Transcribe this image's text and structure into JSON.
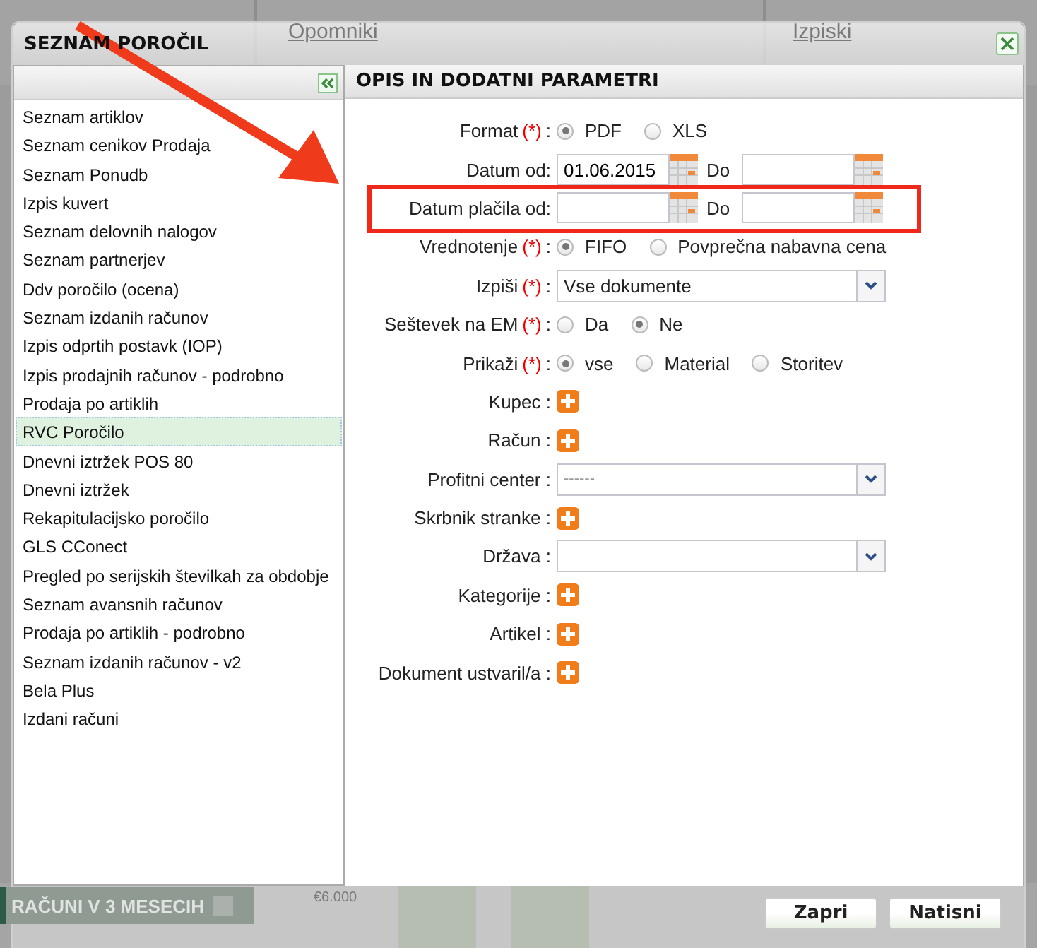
{
  "background": {
    "links": [
      "Opomniki",
      "Izpiski"
    ],
    "panel_title": "RAČUNI V 3 MESECIH",
    "axis_label": "€6.000"
  },
  "dialog": {
    "title": "SEZNAM POROČIL",
    "reports": [
      {
        "label": "Seznam artiklov",
        "selected": false
      },
      {
        "label": "Seznam cenikov Prodaja",
        "selected": false
      },
      {
        "label": "Seznam Ponudb",
        "selected": false
      },
      {
        "label": "Izpis kuvert",
        "selected": false
      },
      {
        "label": "Seznam delovnih nalogov",
        "selected": false
      },
      {
        "label": "Seznam partnerjev",
        "selected": false
      },
      {
        "label": "Ddv poročilo (ocena)",
        "selected": false
      },
      {
        "label": "Seznam izdanih računov",
        "selected": false
      },
      {
        "label": "Izpis odprtih postavk (IOP)",
        "selected": false
      },
      {
        "label": "Izpis prodajnih računov - podrobno",
        "selected": false
      },
      {
        "label": "Prodaja po artiklih",
        "selected": false
      },
      {
        "label": "RVC Poročilo",
        "selected": true
      },
      {
        "label": "Dnevni iztržek POS 80",
        "selected": false
      },
      {
        "label": "Dnevni iztržek",
        "selected": false
      },
      {
        "label": "Rekapitulacijsko poročilo",
        "selected": false
      },
      {
        "label": "GLS CConect",
        "selected": false
      },
      {
        "label": "Pregled po serijskih številkah za obdobje",
        "selected": false
      },
      {
        "label": "Seznam avansnih računov",
        "selected": false
      },
      {
        "label": "Prodaja po artiklih - podrobno",
        "selected": false
      },
      {
        "label": "Seznam izdanih računov - v2",
        "selected": false
      },
      {
        "label": "Bela Plus",
        "selected": false
      },
      {
        "label": "Izdani računi",
        "selected": false
      }
    ],
    "params_title": "OPIS IN DODATNI PARAMETRI",
    "fields": [
      {
        "kind": "radio",
        "label": "Format",
        "required_mark": "(*)",
        "colon": ":",
        "highlighted": false,
        "options": [
          {
            "label": "PDF",
            "selected": true
          },
          {
            "label": "XLS",
            "selected": false
          }
        ]
      },
      {
        "kind": "date_range",
        "label": "Datum od:",
        "highlighted": false,
        "value_from": "01.06.2015",
        "to_label": "Do"
      },
      {
        "kind": "date_range",
        "label": "Datum plačila od:",
        "highlighted": true,
        "to_label": "Do"
      },
      {
        "kind": "radio",
        "label": "Vrednotenje",
        "required_mark": "(*)",
        "colon": ":",
        "highlighted": false,
        "options": [
          {
            "label": "FIFO",
            "selected": true
          },
          {
            "label": "Povprečna nabavna cena",
            "selected": false
          }
        ]
      },
      {
        "kind": "select",
        "label": "Izpiši",
        "required_mark": "(*)",
        "colon": ":",
        "highlighted": false,
        "value": "Vse dokumente"
      },
      {
        "kind": "radio",
        "label": "Seštevek na EM",
        "required_mark": "(*)",
        "colon": ":",
        "highlighted": false,
        "options": [
          {
            "label": "Da",
            "selected": false
          },
          {
            "label": "Ne",
            "selected": true
          }
        ]
      },
      {
        "kind": "radio",
        "label": "Prikaži",
        "required_mark": "(*)",
        "colon": ":",
        "highlighted": false,
        "options": [
          {
            "label": "vse",
            "selected": true
          },
          {
            "label": "Material",
            "selected": false
          },
          {
            "label": "Storitev",
            "selected": false
          }
        ]
      },
      {
        "kind": "add",
        "label": "Kupec :",
        "highlighted": false
      },
      {
        "kind": "add",
        "label": "Račun :",
        "highlighted": false
      },
      {
        "kind": "select",
        "label": "Profitni center :",
        "highlighted": false,
        "placeholder": "------"
      },
      {
        "kind": "add",
        "label": "Skrbnik stranke :",
        "highlighted": false
      },
      {
        "kind": "select",
        "label": "Država :",
        "highlighted": false
      },
      {
        "kind": "add",
        "label": "Kategorije :",
        "highlighted": false
      },
      {
        "kind": "add",
        "label": "Artikel :",
        "highlighted": false
      },
      {
        "kind": "add",
        "label": "Dokument ustvaril/a :",
        "highlighted": false
      }
    ],
    "buttons": [
      "Zapri",
      "Natisni"
    ]
  }
}
